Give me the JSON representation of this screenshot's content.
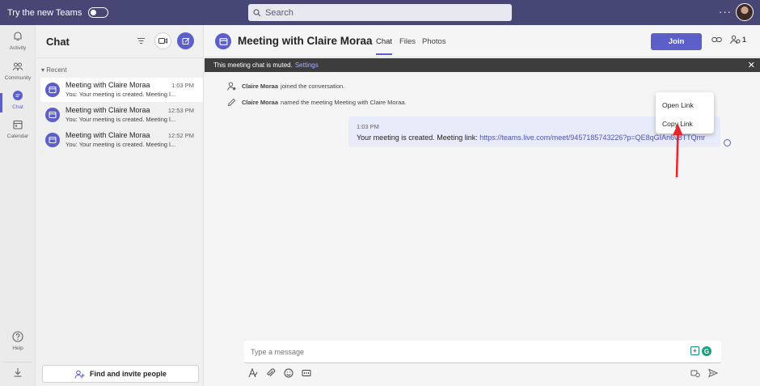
{
  "topbar": {
    "try_new_label": "Try the new Teams",
    "search_placeholder": "Search",
    "more_glyph": "···"
  },
  "rail": {
    "items": [
      {
        "label": "Activity",
        "icon": "bell-icon"
      },
      {
        "label": "Community",
        "icon": "community-icon"
      },
      {
        "label": "Chat",
        "icon": "chat-icon",
        "active": true
      },
      {
        "label": "Calendar",
        "icon": "calendar-icon"
      }
    ],
    "help_label": "Help"
  },
  "chat_pane": {
    "title": "Chat",
    "recent_label": "Recent",
    "items": [
      {
        "name": "Meeting with Claire Moraa",
        "time": "1:03 PM",
        "preview": "You: Your meeting is created. Meeting l...",
        "selected": true
      },
      {
        "name": "Meeting with Claire Moraa",
        "time": "12:53 PM",
        "preview": "You: Your meeting is created. Meeting l..."
      },
      {
        "name": "Meeting with Claire Moraa",
        "time": "12:52 PM",
        "preview": "You: Your meeting is created. Meeting l..."
      }
    ],
    "invite_label": "Find and invite people"
  },
  "header": {
    "title": "Meeting with Claire Moraa",
    "tabs": [
      "Chat",
      "Files",
      "Photos"
    ],
    "join_label": "Join",
    "people_count": "1"
  },
  "muted_bar": {
    "text": "This meeting chat is muted.",
    "link": "Settings"
  },
  "messages": {
    "system": [
      {
        "name": "Claire Moraa",
        "text": "joined the conversation."
      },
      {
        "name": "Claire Moraa",
        "text": "named the meeting Meeting with Claire Moraa."
      }
    ],
    "bubble_time": "1:03 PM",
    "bubble_text": "Your meeting is created. Meeting link:",
    "bubble_link": "https://teams.live.com/meet/9457185743226?p=QE8qGIAn6v8TTQmr"
  },
  "context_menu": {
    "items": [
      "Open Link",
      "Copy Link"
    ]
  },
  "composer": {
    "placeholder": "Type a message"
  },
  "colors": {
    "brand": "#5b5fc7",
    "topbar": "#464775",
    "annotation_arrow": "#e8252b"
  }
}
